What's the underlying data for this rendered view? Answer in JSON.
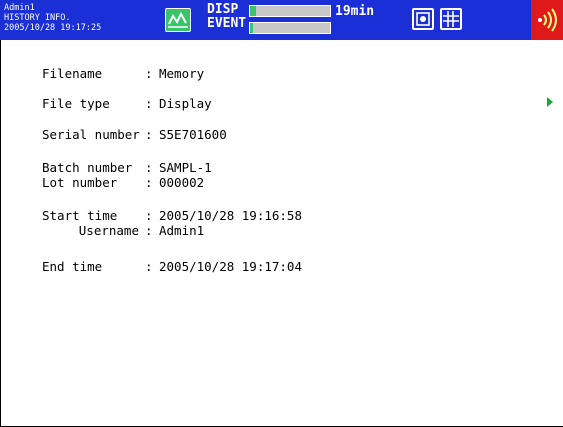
{
  "header": {
    "user": "Admin1",
    "screen_name": "HISTORY INFO.",
    "datetime": "2005/10/28 19:17:25",
    "mode_top": "DISP",
    "mode_bottom": "EVENT",
    "disp_fill": 0.08,
    "event_fill": 0.04,
    "remaining": "19min",
    "icons": [
      "display-mode-icon",
      "memory-media-icon",
      "grid-icon",
      "alarm-icon"
    ],
    "colors": {
      "bar": "#1a2fd6",
      "alarm": "#e01a1a",
      "accent": "#39c46a"
    }
  },
  "details": {
    "filename_label": "Filename",
    "filename_value": "Memory",
    "filetype_label": "File type",
    "filetype_value": "Display",
    "serial_label": "Serial number",
    "serial_value": "S5E701600",
    "batch_label": "Batch number",
    "batch_value": "SAMPL-1",
    "lot_label": "Lot number",
    "lot_value": "000002",
    "start_label": "Start time",
    "start_value": "2005/10/28 19:16:58",
    "username_label": "Username",
    "username_value": "Admin1",
    "end_label": "End time",
    "end_value": "2005/10/28 19:17:04",
    "separator": ":"
  }
}
